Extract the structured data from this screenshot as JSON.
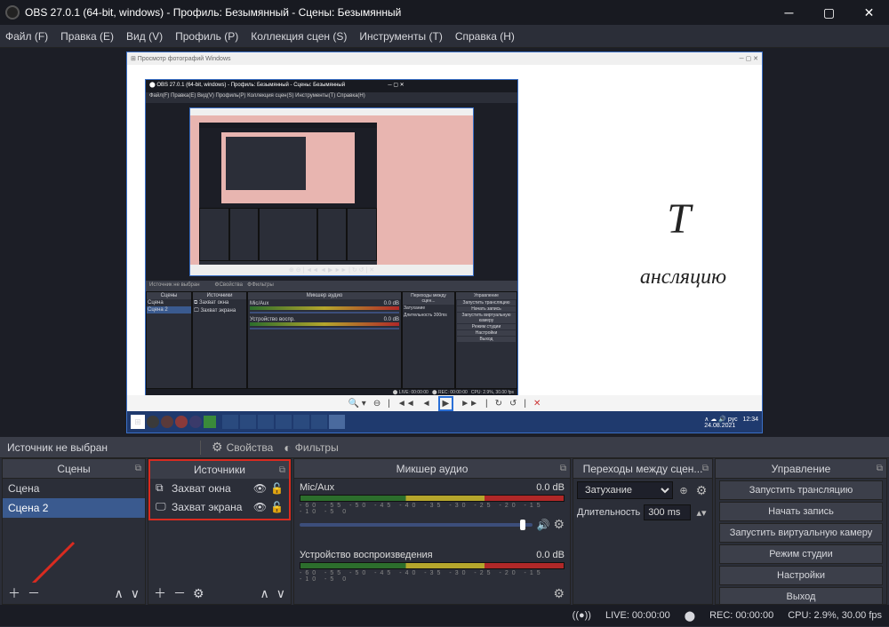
{
  "window": {
    "title": "OBS 27.0.1 (64-bit, windows) - Профиль: Безымянный - Сцены: Безымянный"
  },
  "menu": {
    "file": "Файл (F)",
    "edit": "Правка (E)",
    "view": "Вид (V)",
    "profile": "Профиль (P)",
    "scenes": "Коллекция сцен (S)",
    "tools": "Инструменты (T)",
    "help": "Справка (H)"
  },
  "midtoolbar": {
    "no_source": "Источник не выбран",
    "properties": "Свойства",
    "filters": "Фильтры"
  },
  "docks": {
    "scenes": {
      "title": "Сцены",
      "items": [
        "Сцена",
        "Сцена 2"
      ],
      "selected": 1
    },
    "sources": {
      "title": "Источники",
      "items": [
        {
          "icon": "⧉",
          "name": "Захват окна"
        },
        {
          "icon": "🖵",
          "name": "Захват экрана"
        }
      ]
    },
    "mixer": {
      "title": "Микшер аудио",
      "channels": [
        {
          "name": "Mic/Aux",
          "db": "0.0 dB"
        },
        {
          "name": "Устройство воспроизведения",
          "db": "0.0 dB"
        }
      ]
    },
    "transitions": {
      "title": "Переходы между сцен...",
      "fade_label": "Затухание",
      "duration_label": "Длительность",
      "duration_value": "300 ms"
    },
    "controls": {
      "title": "Управление",
      "buttons": {
        "stream": "Запустить трансляцию",
        "record": "Начать запись",
        "vcam": "Запустить виртуальную камеру",
        "studio": "Режим студии",
        "settings": "Настройки",
        "exit": "Выход"
      }
    }
  },
  "statusbar": {
    "live": "LIVE: 00:00:00",
    "rec": "REC: 00:00:00",
    "cpu": "CPU: 2.9%, 30.00 fps"
  },
  "preview_inner": {
    "text1": "ансляцию",
    "text2": "T"
  }
}
